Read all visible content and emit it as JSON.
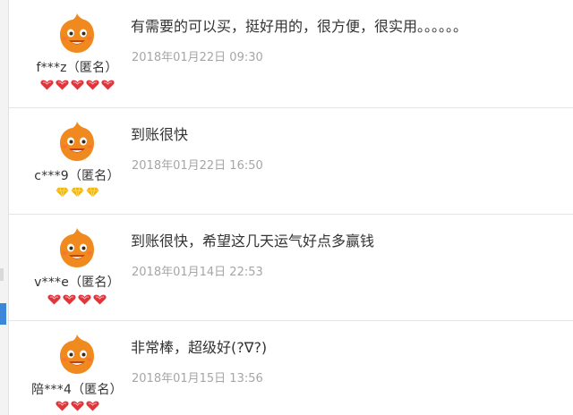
{
  "reviews": [
    {
      "user": "f***z（匿名）",
      "rank_icon": "red-heart-icon",
      "rank_color": "#e0353b",
      "rank_count": 5,
      "content": "有需要的可以买，挺好用的，很方便，很实用。。。。。。",
      "date": "2018年01月22日 09:30"
    },
    {
      "user": "c***9（匿名）",
      "rank_icon": "yellow-diamond-icon",
      "rank_color": "#f2b705",
      "rank_count": 3,
      "content": "到账很快",
      "date": "2018年01月22日 16:50"
    },
    {
      "user": "v***e（匿名）",
      "rank_icon": "red-heart-icon",
      "rank_color": "#e0353b",
      "rank_count": 4,
      "content": "到账很快，希望这几天运气好点多赢钱",
      "date": "2018年01月14日 22:53"
    },
    {
      "user": "陪***4（匿名）",
      "rank_icon": "red-heart-icon",
      "rank_color": "#e0353b",
      "rank_count": 3,
      "content": "非常棒，超级好(?∇?)",
      "date": "2018年01月15日 13:56"
    }
  ],
  "avatar_icon": "orange-mascot-icon",
  "colors": {
    "avatar": "#f08a1f",
    "divider": "#e5e5e5"
  }
}
